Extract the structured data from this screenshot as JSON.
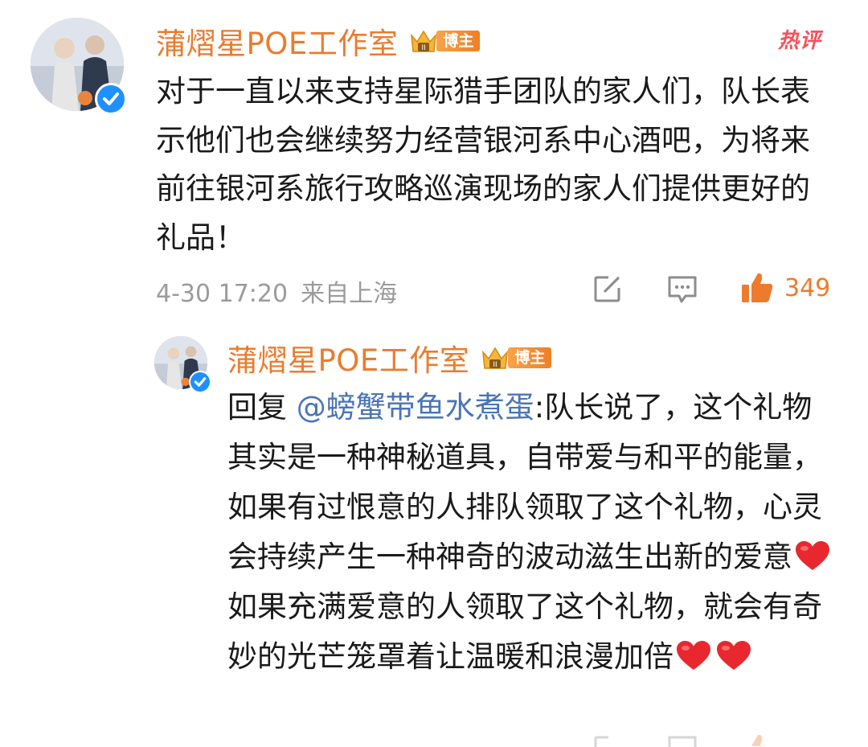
{
  "hot_label": "热评",
  "comment": {
    "author": "蒲熠星POE工作室",
    "badge": "博主",
    "text": "对于一直以来支持星际猎手团队的家人们，队长表示他们也会继续努力经营银河系中心酒吧，为将来前往银河系旅行攻略巡演现场的家人们提供更好的礼品！",
    "date": "4-30 17:20",
    "location": "来自上海",
    "likes": "349",
    "icons": [
      "edit-icon",
      "comment-icon",
      "like-icon"
    ]
  },
  "reply": {
    "author": "蒲熠星POE工作室",
    "badge": "博主",
    "prefix": "回复 ",
    "mention": "@螃蟹带鱼水煮蛋",
    "text_part1": ":队长说了，这个礼物其实是一种神秘道具，自带爱与和平的能量，如果有过恨意的人排队领取了这个礼物，心灵会持续产生一种神奇的波动滋生出新的爱意",
    "text_part2": "如果充满爱意的人领取了这个礼物，就会有奇妙的光芒笼罩着让温暖和浪漫加倍",
    "emoji": "red-heart"
  },
  "colors": {
    "author": "#ea7b2e",
    "badge": "#f08a2c",
    "like": "#ee7b2d",
    "mention": "#4b74b6",
    "hot": "#f4525b",
    "verify": "#1e90ff",
    "meta": "#9b9b9b"
  }
}
